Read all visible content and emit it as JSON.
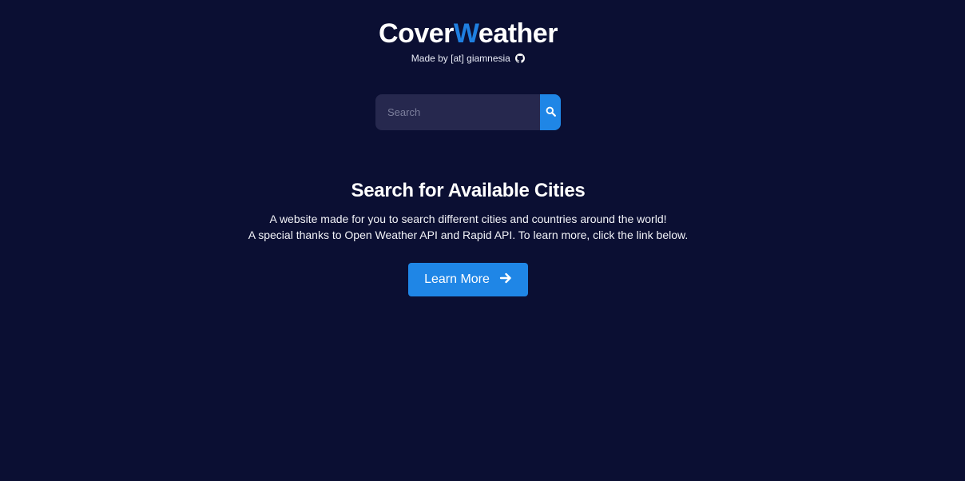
{
  "brand": {
    "part1": "Cover",
    "accent": "W",
    "part2": "eather",
    "accent_color": "#1f7fe0"
  },
  "credit": {
    "text": "Made by [at] giamnesia",
    "icon": "github-icon"
  },
  "search": {
    "placeholder": "Search",
    "value": "",
    "button_icon": "search-icon"
  },
  "main": {
    "heading": "Search for Available Cities",
    "line1": "A website made for you to search different cities and countries around the world!",
    "line2": "A special thanks to Open Weather API and Rapid API. To learn more, click the link below.",
    "button_label": "Learn More",
    "button_icon": "arrow-right-icon"
  },
  "colors": {
    "background": "#0b0f33",
    "primary": "#1f86e6",
    "input_bg": "#26284e"
  }
}
